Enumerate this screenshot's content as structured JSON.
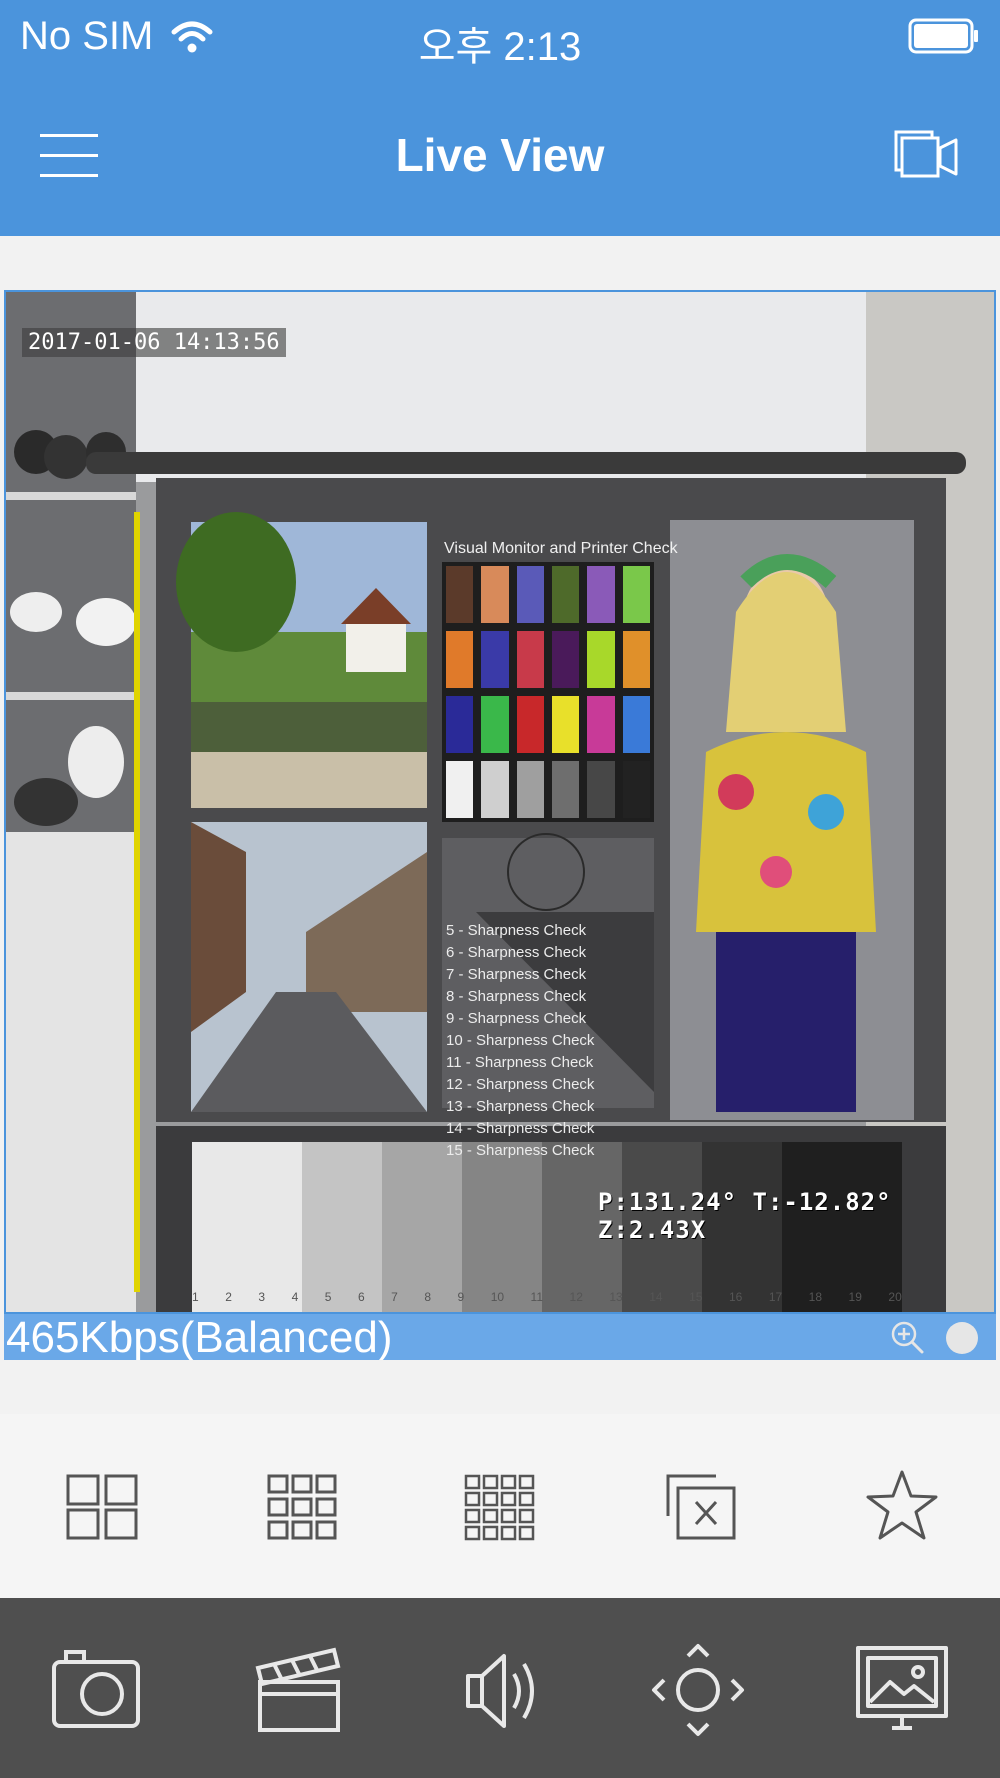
{
  "status_bar": {
    "carrier": "No SIM",
    "time": "오후 2:13"
  },
  "nav": {
    "title": "Live View",
    "menu_icon": "hamburger-menu-icon",
    "right_icon": "camera-switch-icon"
  },
  "video": {
    "timestamp": "2017-01-06 14:13:56",
    "ptz_readout": "P:131.24°  T:-12.82°  Z:2.43X",
    "chart_heading": "Visual Monitor and Printer Check",
    "sharpness_items": [
      "5 - Sharpness Check",
      "6 - Sharpness Check",
      "7 - Sharpness Check",
      "8 - Sharpness Check",
      "9 - Sharpness Check",
      "10 - Sharpness Check",
      "11 - Sharpness Check",
      "12 - Sharpness Check",
      "13 - Sharpness Check",
      "14 - Sharpness Check",
      "15 - Sharpness Check"
    ],
    "grey_scale_numbers": [
      "1",
      "2",
      "3",
      "4",
      "5",
      "6",
      "7",
      "8",
      "9",
      "10",
      "11",
      "12",
      "13",
      "14",
      "15",
      "16",
      "17",
      "18",
      "19",
      "20"
    ]
  },
  "stream": {
    "bitrate": "465Kbps(Balanced)"
  },
  "layout_bar": {
    "buttons": [
      "layout-4-split-icon",
      "layout-9-split-icon",
      "layout-16-split-icon",
      "close-all-icon",
      "favorite-star-icon"
    ]
  },
  "toolbar": {
    "buttons": [
      "snapshot-camera-icon",
      "record-clapper-icon",
      "audio-speaker-icon",
      "ptz-control-icon",
      "image-adjust-icon"
    ]
  },
  "colors": {
    "accent": "#4b94dc",
    "bitrate_bar": "#6aa8e8",
    "toolbar_bg": "#4f4f4f"
  }
}
